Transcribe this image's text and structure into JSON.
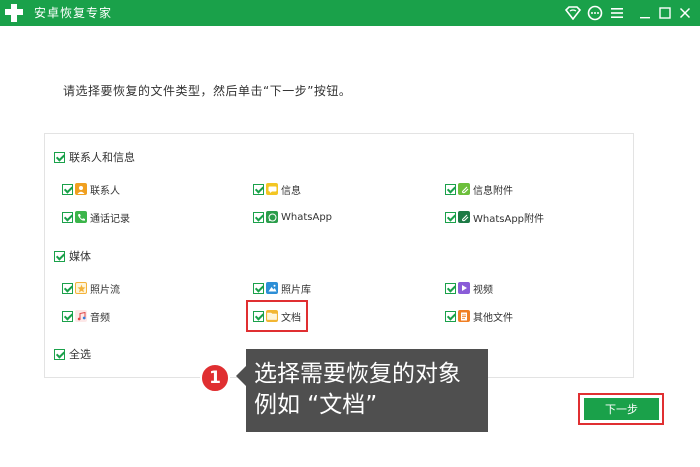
{
  "app": {
    "title": "安卓恢复专家"
  },
  "titlebar": {
    "icons": [
      "wifi-diamond-icon",
      "chat-icon",
      "menu-icon",
      "minimize-icon",
      "maximize-icon",
      "close-icon"
    ]
  },
  "instruction": "请选择要恢复的文件类型，然后单击“下一步”按钮。",
  "groups": [
    {
      "label": "联系人和信息",
      "checked": true,
      "items": [
        {
          "label": "联系人",
          "icon": "contact-icon",
          "color": "#f0a020",
          "checked": true
        },
        {
          "label": "信息",
          "icon": "message-icon",
          "color": "#f3c623",
          "checked": true
        },
        {
          "label": "信息附件",
          "icon": "attachment-icon",
          "color": "#6cbf3b",
          "checked": true
        },
        {
          "label": "通话记录",
          "icon": "phone-icon",
          "color": "#3bb54a",
          "checked": true
        },
        {
          "label": "WhatsApp",
          "icon": "whatsapp-icon",
          "color": "#2a9d4a",
          "checked": true
        },
        {
          "label": "WhatsApp附件",
          "icon": "whatsapp-attachment-icon",
          "color": "#1d7a45",
          "checked": true
        }
      ]
    },
    {
      "label": "媒体",
      "checked": true,
      "items": [
        {
          "label": "照片流",
          "icon": "photostream-icon",
          "color": "#f4b23a",
          "checked": true
        },
        {
          "label": "照片库",
          "icon": "photo-library-icon",
          "color": "#2d8fd6",
          "checked": true
        },
        {
          "label": "视频",
          "icon": "video-icon",
          "color": "#8a5cd8",
          "checked": true
        },
        {
          "label": "音频",
          "icon": "audio-icon",
          "color": "#e04848",
          "checked": true
        },
        {
          "label": "文档",
          "icon": "folder-icon",
          "color": "#f2b632",
          "checked": true
        },
        {
          "label": "其他文件",
          "icon": "other-files-icon",
          "color": "#f07f24",
          "checked": true
        }
      ]
    }
  ],
  "select_all": {
    "label": "全选",
    "checked": true
  },
  "callout": {
    "number": "1",
    "line1": "选择需要恢复的对象",
    "line2": "例如 “文档”"
  },
  "next_button": "下一步",
  "colors": {
    "brand_green": "#1aa14a",
    "highlight_red": "#e02f31",
    "callout_bg": "#4f4f4f"
  }
}
